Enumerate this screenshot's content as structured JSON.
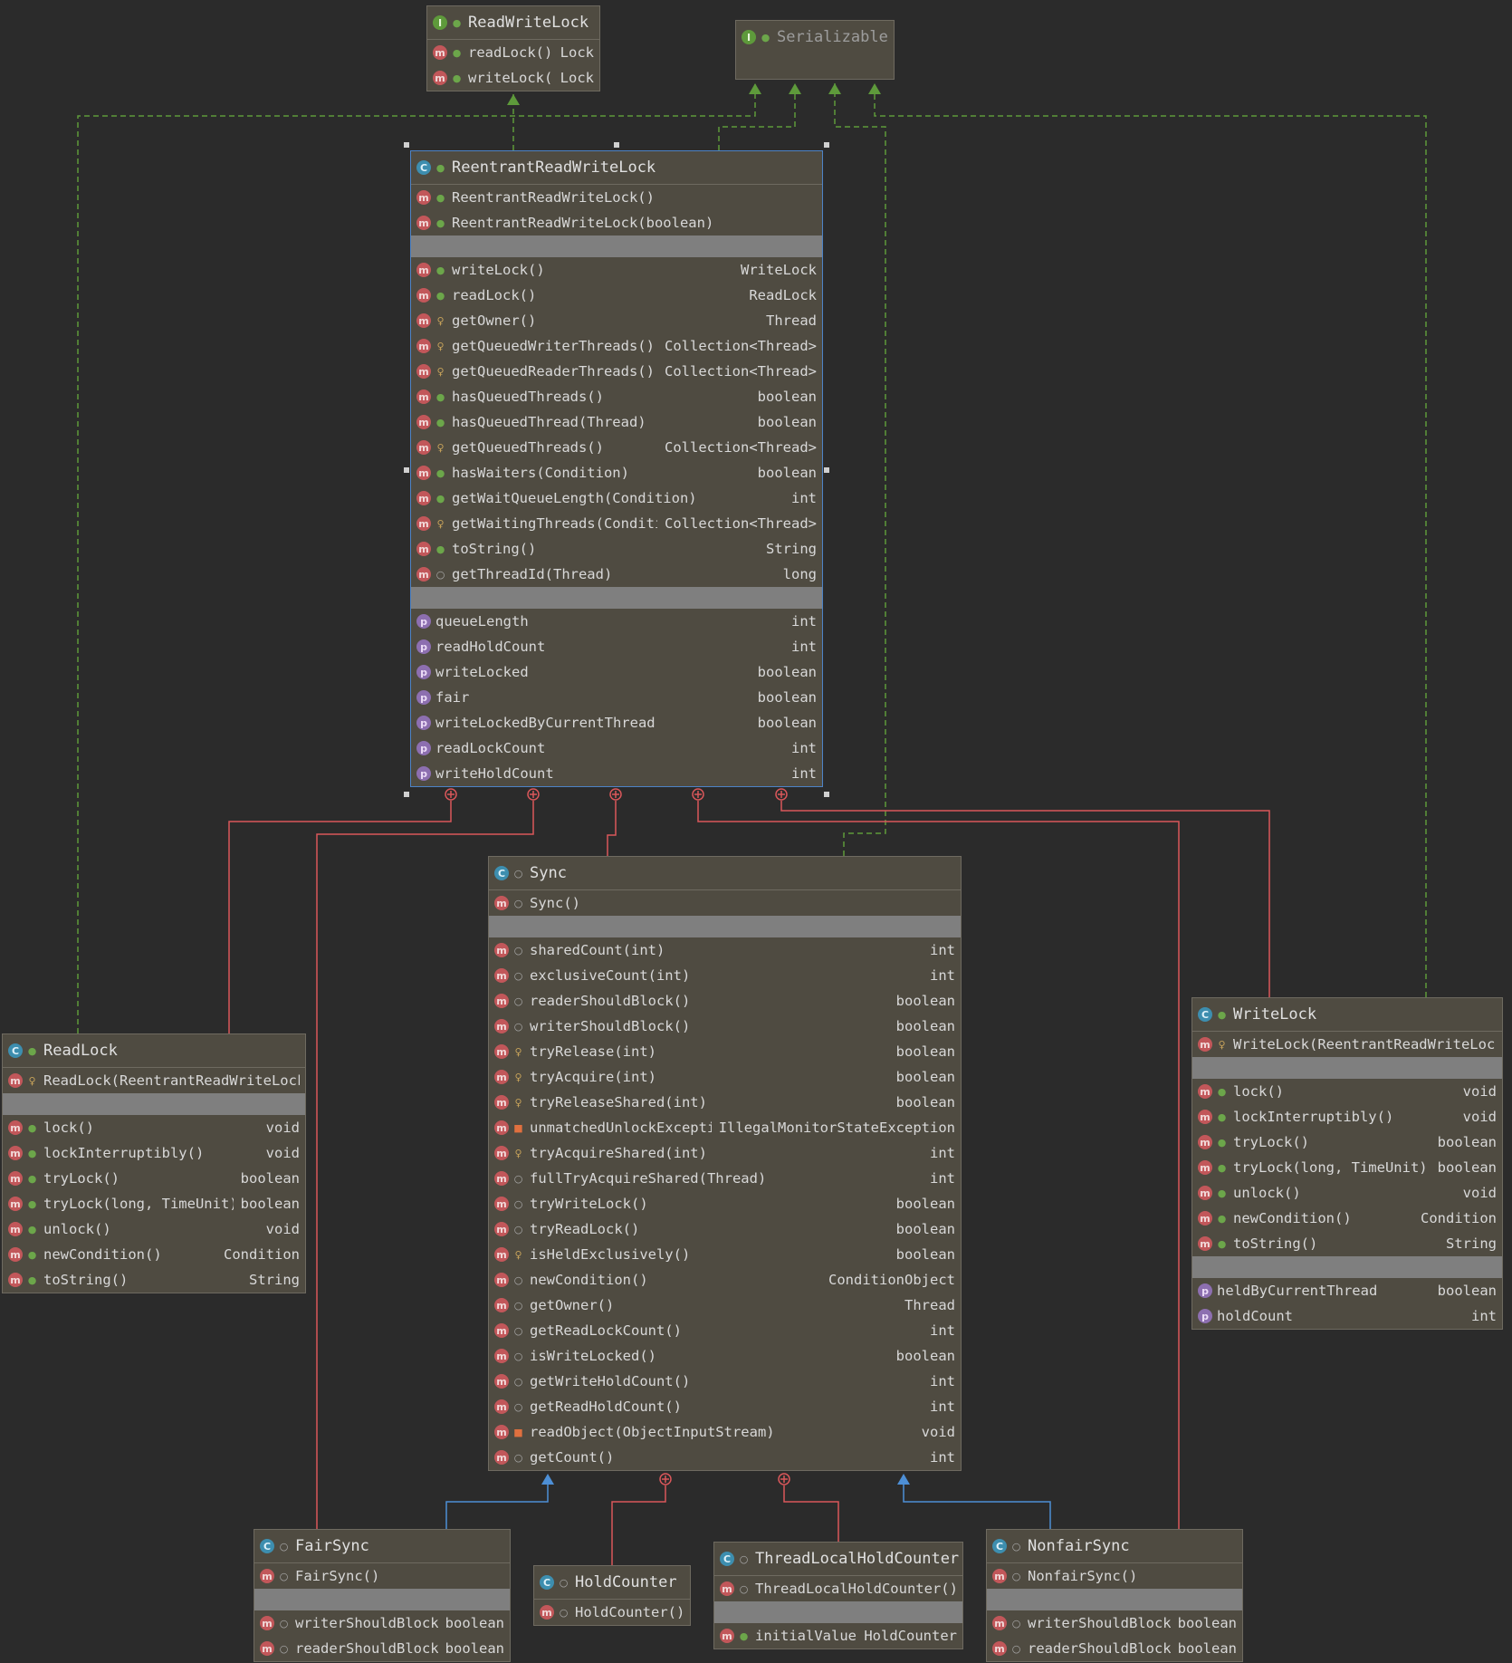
{
  "nodes": {
    "readwritelock": {
      "name": "ReadWriteLock",
      "kind": "interface",
      "methods": [
        {
          "name": "readLock()",
          "type": "Lock",
          "vis": "public"
        },
        {
          "name": "writeLock()",
          "type": "Lock",
          "vis": "public"
        }
      ]
    },
    "serializable": {
      "name": "Serializable",
      "kind": "interface"
    },
    "reentrant": {
      "name": "ReentrantReadWriteLock",
      "kind": "class",
      "constructors": [
        {
          "name": "ReentrantReadWriteLock()",
          "type": "",
          "vis": "public"
        },
        {
          "name": "ReentrantReadWriteLock(boolean)",
          "type": "",
          "vis": "public"
        }
      ],
      "methods": [
        {
          "name": "writeLock()",
          "type": "WriteLock",
          "vis": "public"
        },
        {
          "name": "readLock()",
          "type": "ReadLock",
          "vis": "public"
        },
        {
          "name": "getOwner()",
          "type": "Thread",
          "vis": "protected"
        },
        {
          "name": "getQueuedWriterThreads()",
          "type": "Collection<Thread>",
          "vis": "protected"
        },
        {
          "name": "getQueuedReaderThreads()",
          "type": "Collection<Thread>",
          "vis": "protected"
        },
        {
          "name": "hasQueuedThreads()",
          "type": "boolean",
          "vis": "public"
        },
        {
          "name": "hasQueuedThread(Thread)",
          "type": "boolean",
          "vis": "public"
        },
        {
          "name": "getQueuedThreads()",
          "type": "Collection<Thread>",
          "vis": "protected"
        },
        {
          "name": "hasWaiters(Condition)",
          "type": "boolean",
          "vis": "public"
        },
        {
          "name": "getWaitQueueLength(Condition)",
          "type": "int",
          "vis": "public"
        },
        {
          "name": "getWaitingThreads(Condition)",
          "type": "Collection<Thread>",
          "vis": "protected"
        },
        {
          "name": "toString()",
          "type": "String",
          "vis": "public"
        },
        {
          "name": "getThreadId(Thread)",
          "type": "long",
          "vis": "package"
        }
      ],
      "properties": [
        {
          "name": "queueLength",
          "type": "int"
        },
        {
          "name": "readHoldCount",
          "type": "int"
        },
        {
          "name": "writeLocked",
          "type": "boolean"
        },
        {
          "name": "fair",
          "type": "boolean"
        },
        {
          "name": "writeLockedByCurrentThread",
          "type": "boolean"
        },
        {
          "name": "readLockCount",
          "type": "int"
        },
        {
          "name": "writeHoldCount",
          "type": "int"
        }
      ]
    },
    "sync": {
      "name": "Sync",
      "kind": "abstract-class",
      "constructors": [
        {
          "name": "Sync()",
          "type": "",
          "vis": "package"
        }
      ],
      "methods": [
        {
          "name": "sharedCount(int)",
          "type": "int",
          "vis": "package"
        },
        {
          "name": "exclusiveCount(int)",
          "type": "int",
          "vis": "package"
        },
        {
          "name": "readerShouldBlock()",
          "type": "boolean",
          "vis": "package"
        },
        {
          "name": "writerShouldBlock()",
          "type": "boolean",
          "vis": "package"
        },
        {
          "name": "tryRelease(int)",
          "type": "boolean",
          "vis": "protected"
        },
        {
          "name": "tryAcquire(int)",
          "type": "boolean",
          "vis": "protected"
        },
        {
          "name": "tryReleaseShared(int)",
          "type": "boolean",
          "vis": "protected"
        },
        {
          "name": "unmatchedUnlockException()",
          "type": "IllegalMonitorStateException",
          "vis": "private"
        },
        {
          "name": "tryAcquireShared(int)",
          "type": "int",
          "vis": "protected"
        },
        {
          "name": "fullTryAcquireShared(Thread)",
          "type": "int",
          "vis": "package"
        },
        {
          "name": "tryWriteLock()",
          "type": "boolean",
          "vis": "package"
        },
        {
          "name": "tryReadLock()",
          "type": "boolean",
          "vis": "package"
        },
        {
          "name": "isHeldExclusively()",
          "type": "boolean",
          "vis": "protected"
        },
        {
          "name": "newCondition()",
          "type": "ConditionObject",
          "vis": "package"
        },
        {
          "name": "getOwner()",
          "type": "Thread",
          "vis": "package"
        },
        {
          "name": "getReadLockCount()",
          "type": "int",
          "vis": "package"
        },
        {
          "name": "isWriteLocked()",
          "type": "boolean",
          "vis": "package"
        },
        {
          "name": "getWriteHoldCount()",
          "type": "int",
          "vis": "package"
        },
        {
          "name": "getReadHoldCount()",
          "type": "int",
          "vis": "package"
        },
        {
          "name": "readObject(ObjectInputStream)",
          "type": "void",
          "vis": "private"
        },
        {
          "name": "getCount()",
          "type": "int",
          "vis": "package"
        }
      ]
    },
    "readlock": {
      "name": "ReadLock",
      "kind": "class",
      "constructors": [
        {
          "name": "ReadLock(ReentrantReadWriteLock)",
          "type": "",
          "vis": "protected"
        }
      ],
      "methods": [
        {
          "name": "lock()",
          "type": "void",
          "vis": "public"
        },
        {
          "name": "lockInterruptibly()",
          "type": "void",
          "vis": "public"
        },
        {
          "name": "tryLock()",
          "type": "boolean",
          "vis": "public"
        },
        {
          "name": "tryLock(long, TimeUnit)",
          "type": "boolean",
          "vis": "public"
        },
        {
          "name": "unlock()",
          "type": "void",
          "vis": "public"
        },
        {
          "name": "newCondition()",
          "type": "Condition",
          "vis": "public"
        },
        {
          "name": "toString()",
          "type": "String",
          "vis": "public"
        }
      ]
    },
    "writelock": {
      "name": "WriteLock",
      "kind": "class",
      "constructors": [
        {
          "name": "WriteLock(ReentrantReadWriteLock)",
          "type": "",
          "vis": "protected"
        }
      ],
      "methods": [
        {
          "name": "lock()",
          "type": "void",
          "vis": "public"
        },
        {
          "name": "lockInterruptibly()",
          "type": "void",
          "vis": "public"
        },
        {
          "name": "tryLock()",
          "type": "boolean",
          "vis": "public"
        },
        {
          "name": "tryLock(long, TimeUnit)",
          "type": "boolean",
          "vis": "public"
        },
        {
          "name": "unlock()",
          "type": "void",
          "vis": "public"
        },
        {
          "name": "newCondition()",
          "type": "Condition",
          "vis": "public"
        },
        {
          "name": "toString()",
          "type": "String",
          "vis": "public"
        }
      ],
      "properties": [
        {
          "name": "heldByCurrentThread",
          "type": "boolean"
        },
        {
          "name": "holdCount",
          "type": "int"
        }
      ]
    },
    "fairsync": {
      "name": "FairSync",
      "kind": "class",
      "constructors": [
        {
          "name": "FairSync()",
          "type": "",
          "vis": "package"
        }
      ],
      "methods": [
        {
          "name": "writerShouldBlock()",
          "type": "boolean",
          "vis": "package"
        },
        {
          "name": "readerShouldBlock()",
          "type": "boolean",
          "vis": "package"
        }
      ]
    },
    "holdcounter": {
      "name": "HoldCounter",
      "kind": "class",
      "constructors": [
        {
          "name": "HoldCounter()",
          "type": "",
          "vis": "package"
        }
      ]
    },
    "threadlocal": {
      "name": "ThreadLocalHoldCounter",
      "kind": "class",
      "constructors": [
        {
          "name": "ThreadLocalHoldCounter()",
          "type": "",
          "vis": "package"
        }
      ],
      "methods": [
        {
          "name": "initialValue()",
          "type": "HoldCounter",
          "vis": "public"
        }
      ]
    },
    "nonfairsync": {
      "name": "NonfairSync",
      "kind": "class",
      "constructors": [
        {
          "name": "NonfairSync()",
          "type": "",
          "vis": "package"
        }
      ],
      "methods": [
        {
          "name": "writerShouldBlock()",
          "type": "boolean",
          "vis": "package"
        },
        {
          "name": "readerShouldBlock()",
          "type": "boolean",
          "vis": "package"
        }
      ]
    }
  },
  "colors": {
    "background": "#2b2b2b",
    "node_fill": "#4f4b41",
    "realization_edge": "#5e9a3b",
    "inner_class_edge": "#d9575a",
    "inheritance_edge": "#4d8fd6",
    "selection_border": "#4d83c6"
  }
}
